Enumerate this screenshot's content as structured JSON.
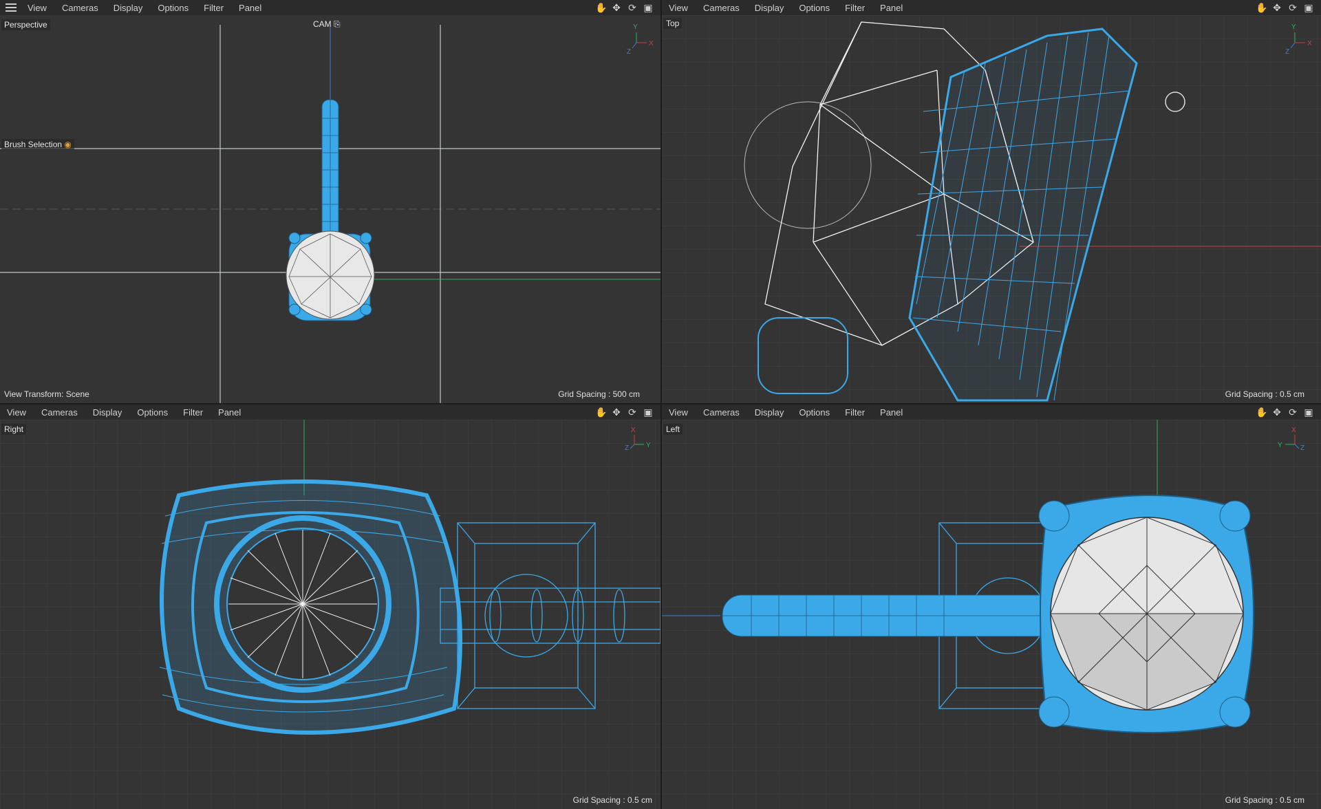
{
  "menu": {
    "view": "View",
    "cameras": "Cameras",
    "display": "Display",
    "options": "Options",
    "filter": "Filter",
    "panel": "Panel"
  },
  "tools": {
    "pan": "✋",
    "move": "✥",
    "rotate": "⟳",
    "maximize": "▣"
  },
  "viewports": {
    "perspective": {
      "name": "Perspective",
      "cam_label": "CAM",
      "brush_label": "Brush Selection",
      "view_transform": "View Transform: Scene",
      "grid_spacing": "Grid Spacing : 500 cm",
      "axis": {
        "x": "X",
        "y": "Y",
        "z": "Z"
      }
    },
    "top": {
      "name": "Top",
      "grid_spacing": "Grid Spacing : 0.5 cm",
      "axis": {
        "x": "X",
        "y": "Y",
        "z": "Z"
      }
    },
    "right": {
      "name": "Right",
      "grid_spacing": "Grid Spacing : 0.5 cm",
      "axis": {
        "x": "X",
        "y": "Y",
        "z": "Z"
      }
    },
    "left": {
      "name": "Left",
      "grid_spacing": "Grid Spacing : 0.5 cm",
      "axis": {
        "x": "X",
        "y": "Y",
        "z": "Z"
      }
    }
  },
  "colors": {
    "viewport_bg": "#343434",
    "grid": "#3e3e3e",
    "wire_blue": "#3ba9e8",
    "wire_white": "#f2f2f2",
    "axis_red": "#d23b3b",
    "axis_green": "#2fae63",
    "axis_blue": "#3a7fd6"
  }
}
